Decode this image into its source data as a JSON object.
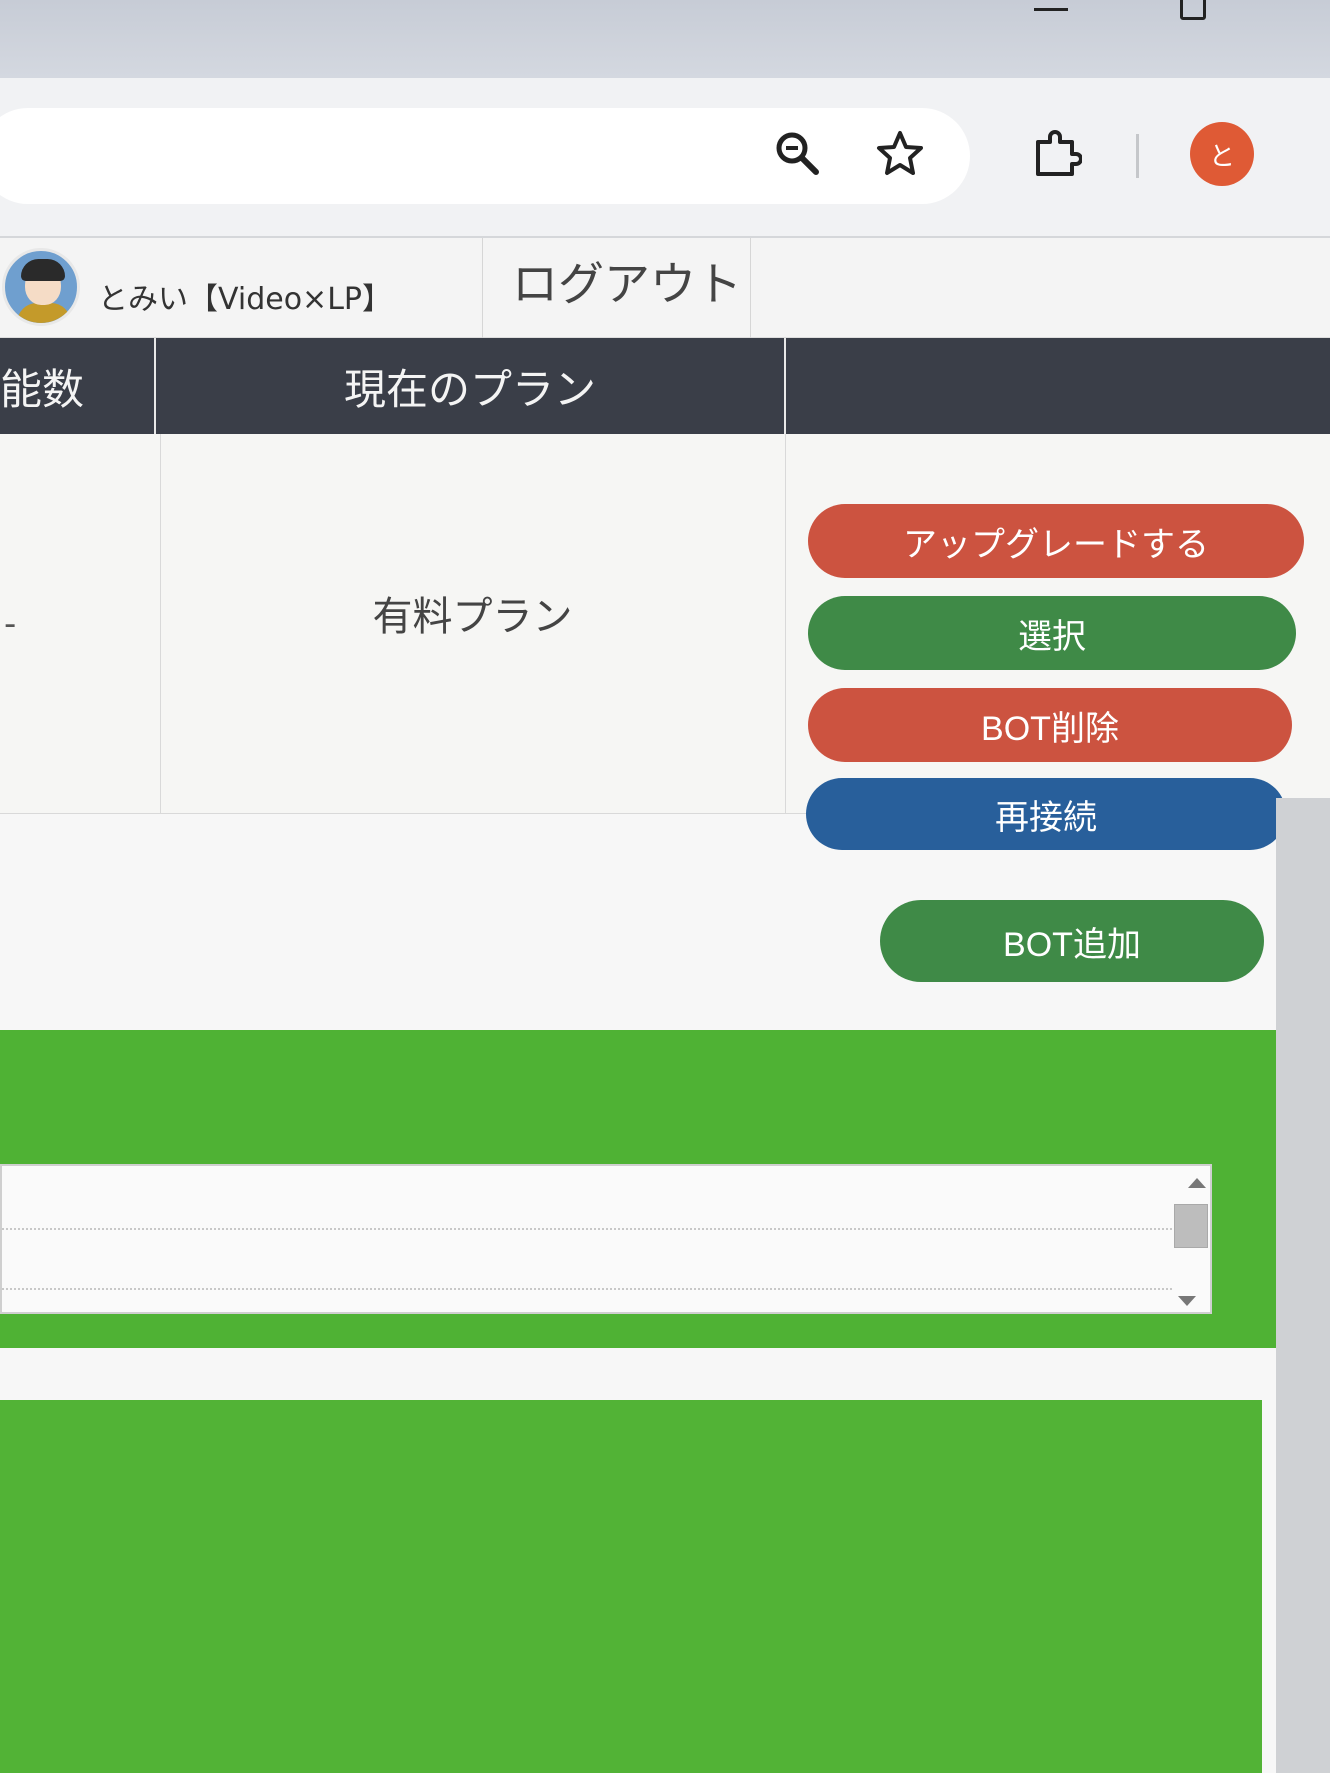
{
  "user": {
    "name": "とみい【Video×LP】"
  },
  "header": {
    "logout_label": "ログアウト"
  },
  "table": {
    "headers": [
      "能数",
      "現在のプラン",
      ""
    ],
    "row": {
      "count": "-",
      "plan": "有料プラン"
    }
  },
  "actions": {
    "upgrade_label": "アップグレードする",
    "select_label": "選択",
    "delete_label": "BOT削除",
    "reconnect_label": "再接続",
    "add_label": "BOT追加"
  },
  "browser": {
    "profile_initial": "と"
  },
  "colors": {
    "header_dark": "#3a3e48",
    "btn_red": "#cc5340",
    "btn_green": "#3f8a47",
    "btn_blue": "#285f9b",
    "panel_green": "#4fb234",
    "profile": "#df5a35"
  }
}
